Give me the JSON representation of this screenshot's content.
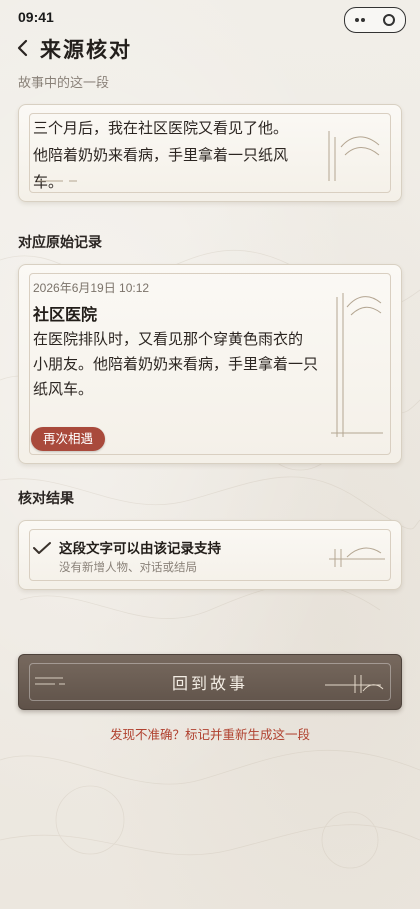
{
  "status_bar": {
    "time": "09:41"
  },
  "header": {
    "title": "来源核对",
    "back_icon": "chevron-left-icon"
  },
  "excerpt": {
    "label": "故事中的这一段",
    "lines": [
      "三个月后，我在社区医院又看见了他。",
      "他陪着奶奶来看病，手里拿着一只纸风车。"
    ]
  },
  "record": {
    "title": "对应原始记录",
    "date": "2026年6月19日 10:12",
    "place": "社区医院",
    "body_lines": [
      "在医院排队时，又看见那个穿黄色雨衣的",
      "小朋友。他陪着奶奶来看病，手里拿着一只",
      "纸风车。"
    ],
    "tag": "再次相遇"
  },
  "result": {
    "title": "核对结果",
    "main": "这段文字可以由该记录支持",
    "sub": "没有新增人物、对话或结局",
    "icon": "check-icon"
  },
  "actions": {
    "primary": "回到故事",
    "report": "发现不准确？标记并重新生成这一段"
  },
  "colors": {
    "accent": "#a94a3c",
    "button": "#6a5d53",
    "link": "#b0412f"
  }
}
